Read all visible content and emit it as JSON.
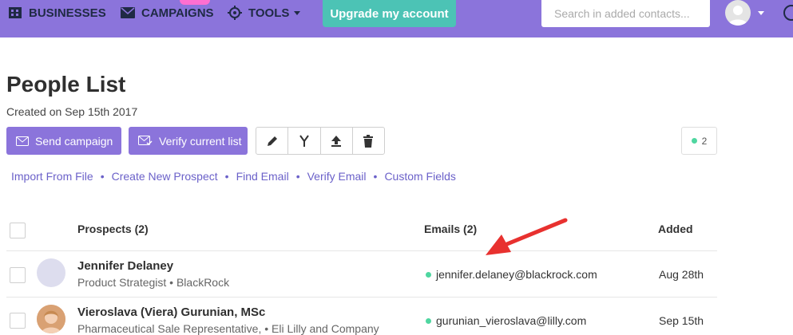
{
  "nav": {
    "businesses": "BUSINESSES",
    "campaigns": "CAMPAIGNS",
    "tools": "TOOLS",
    "upgrade": "Upgrade my account",
    "search_placeholder": "Search in added contacts..."
  },
  "page": {
    "title": "People List",
    "subtitle": "Created on Sep 15th 2017"
  },
  "actions": {
    "send_campaign": "Send campaign",
    "verify_list": "Verify current list",
    "count": "2"
  },
  "links": {
    "import": "Import From File",
    "create": "Create New Prospect",
    "find": "Find Email",
    "verify": "Verify Email",
    "custom": "Custom Fields",
    "separator": "•"
  },
  "table": {
    "headers": {
      "prospects": "Prospects (2)",
      "emails": "Emails (2)",
      "added": "Added"
    },
    "rows": [
      {
        "name": "Jennifer Delaney",
        "subtitle": "Product Strategist • BlackRock",
        "email": "jennifer.delaney@blackrock.com",
        "added": "Aug 28th"
      },
      {
        "name": "Vieroslava (Viera) Gurunian, MSc",
        "subtitle": "Pharmaceutical Sale Representative, • Eli Lilly and Company",
        "email": "gurunian_vieroslava@lilly.com",
        "added": "Sep 15th"
      }
    ]
  },
  "colors": {
    "nav_bg": "#8b74db",
    "upgrade_bg": "#4cc3b5",
    "link": "#6b61c9",
    "status_dot": "#4fd6a0",
    "arrow": "#e8312f"
  }
}
